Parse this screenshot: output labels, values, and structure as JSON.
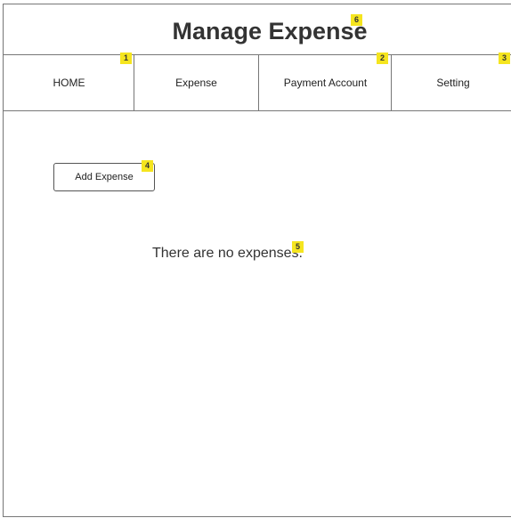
{
  "page": {
    "title": "Manage Expense"
  },
  "nav": {
    "items": [
      {
        "label": "HOME"
      },
      {
        "label": "Expense"
      },
      {
        "label": "Payment Account"
      },
      {
        "label": "Setting"
      }
    ]
  },
  "content": {
    "add_button_label": "Add Expense",
    "empty_message": "There are no expenses."
  },
  "annotations": {
    "badges": [
      "1",
      "2",
      "3",
      "4",
      "5",
      "6"
    ]
  },
  "colors": {
    "badge": "#f5e51f",
    "border": "#777777",
    "title_text": "#333333"
  }
}
